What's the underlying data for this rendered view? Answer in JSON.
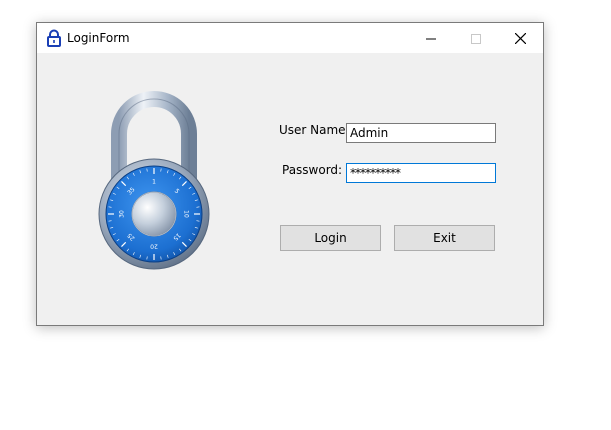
{
  "window": {
    "title": "LoginForm",
    "icon": "lock-icon",
    "controls": {
      "minimize_icon": "minimize-icon",
      "maximize_icon": "maximize-icon",
      "close_icon": "close-icon"
    }
  },
  "form": {
    "username_label": "User Name:",
    "username_value": "Admin",
    "password_label": "Password:",
    "password_value": "**********",
    "login_label": "Login",
    "exit_label": "Exit"
  },
  "illustration": {
    "dial_numbers": [
      "1",
      "5",
      "10",
      "15",
      "20",
      "25",
      "30",
      "35"
    ],
    "colors": {
      "dial_blue": "#1c6fd1",
      "shackle_silver": "#b9c6d6"
    }
  }
}
